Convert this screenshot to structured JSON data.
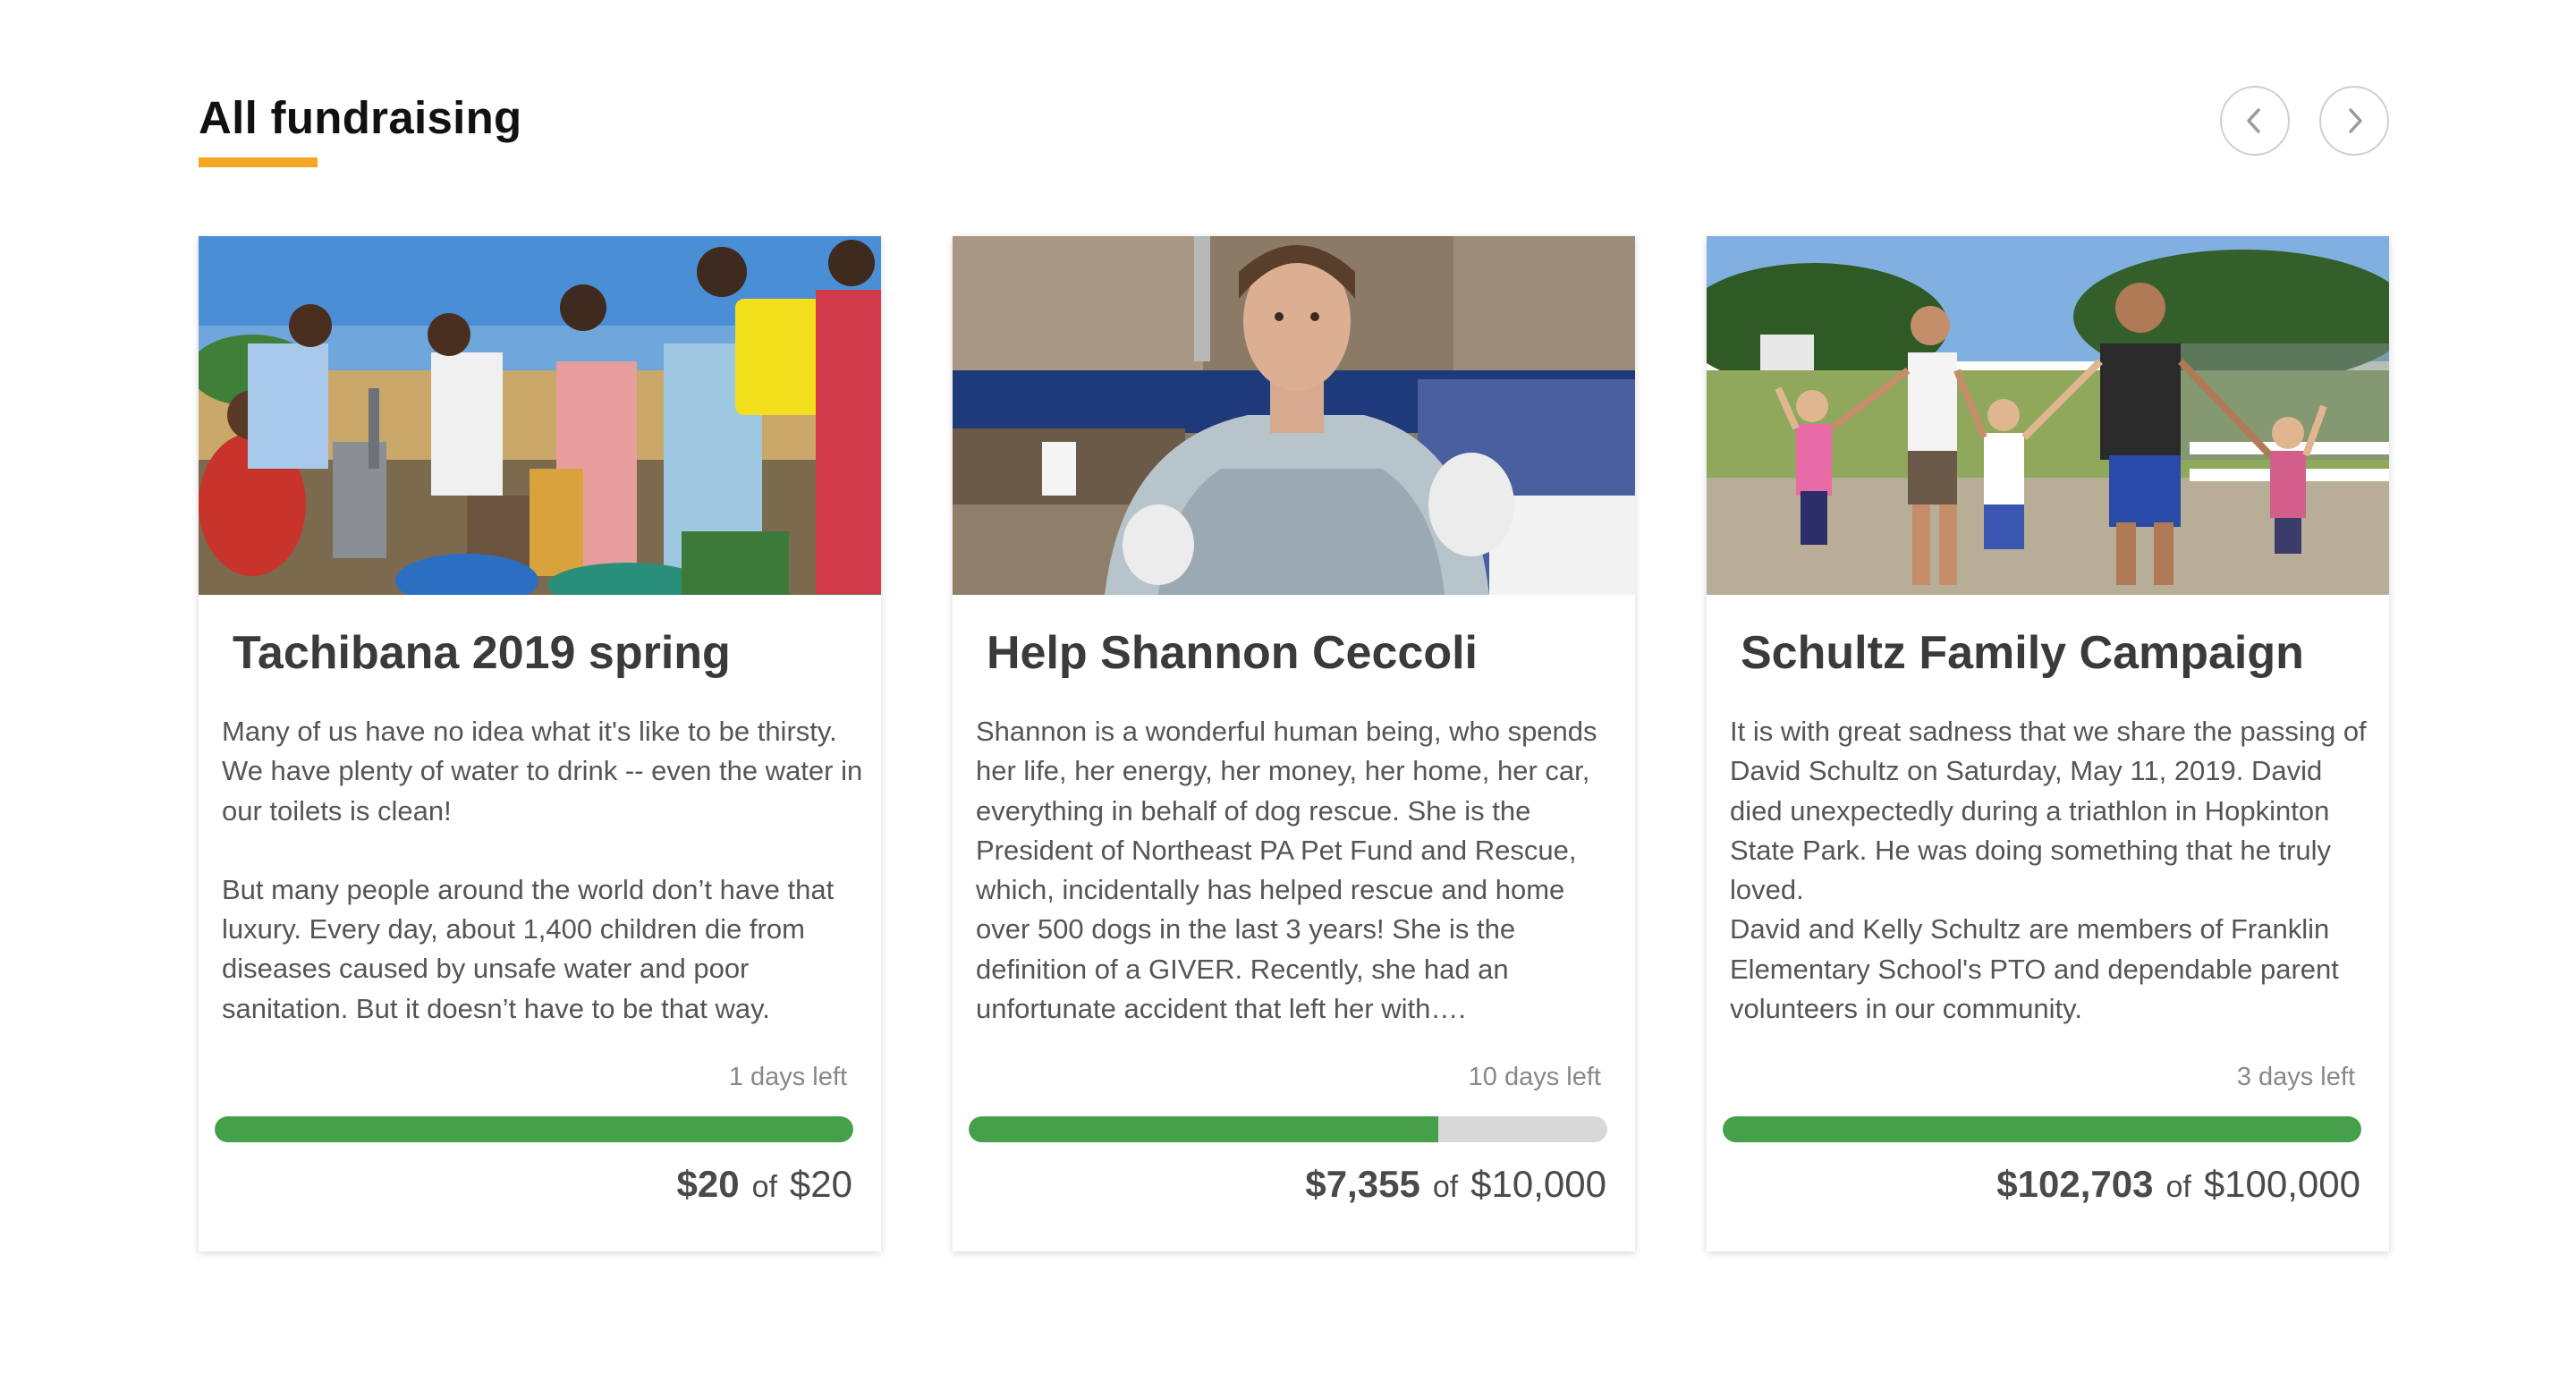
{
  "section": {
    "title": "All fundraising",
    "accent_color": "#f5a623",
    "prev_icon": "chevron-left-icon",
    "next_icon": "chevron-right-icon"
  },
  "campaigns": [
    {
      "title": "Tachibana 2019 spring",
      "description": [
        "Many of us have no idea what it's like to be thirsty. We have plenty of water to drink -- even the water in our toilets is clean!",
        "But many people around the world don’t have that luxury. Every day, about 1,400 children die from diseases caused by unsafe water and poor sanitation. But it doesn’t have to be that way."
      ],
      "days_left": "1 days left",
      "raised": "$20",
      "of_label": "of",
      "goal": "$20",
      "progress_fraction": 1.0
    },
    {
      "title": "Help Shannon Ceccoli",
      "description": [
        "Shannon is a wonderful human being, who spends her life, her energy, her money, her home, her car, everything in behalf of dog rescue. She is the President of Northeast PA Pet Fund and Rescue, which, incidentally has helped rescue and home over 500 dogs in the last 3 years! She is the definition of a GIVER. Recently, she had an unfortunate accident that left her with…."
      ],
      "days_left": "10 days left",
      "raised": "$7,355",
      "of_label": "of",
      "goal": "$10,000",
      "progress_fraction": 0.7355
    },
    {
      "title": "Schultz Family Campaign",
      "description": [
        "It is with great sadness that we share the passing of David Schultz on Saturday, May 11, 2019. David died unexpectedly during a triathlon in Hopkinton State Park.  He was doing something that he truly loved.",
        "David and Kelly Schultz are members of Franklin Elementary School's PTO and dependable parent volunteers in our community."
      ],
      "days_left": "3 days left",
      "raised": "$102,703",
      "of_label": "of",
      "goal": "$100,000",
      "progress_fraction": 1.0
    }
  ],
  "colors": {
    "progress_fill": "#45a049",
    "progress_track": "#d8d8d8"
  }
}
